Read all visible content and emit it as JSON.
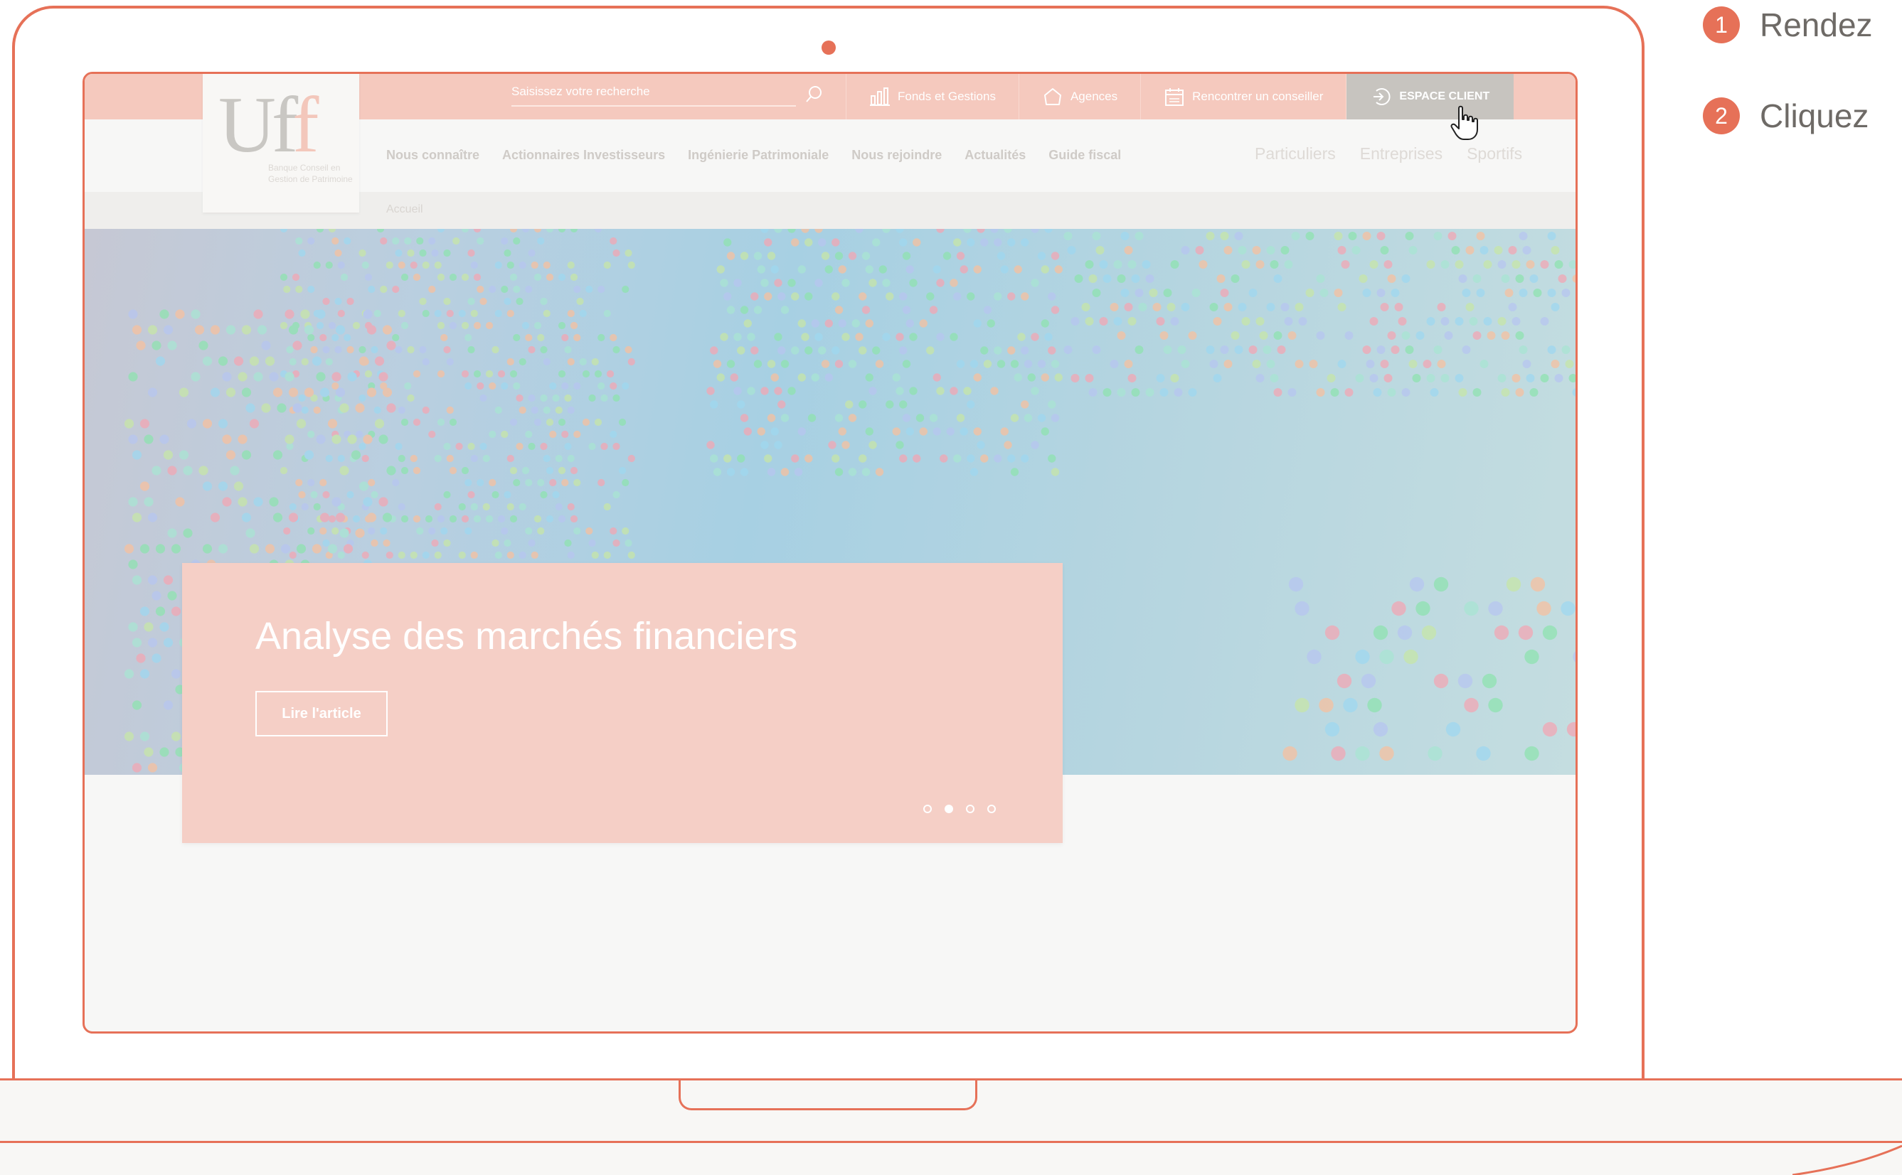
{
  "header": {
    "search": {
      "placeholder": "Saisissez votre recherche"
    },
    "topnav": [
      {
        "label": "Fonds et Gestions",
        "icon": "bar-chart-icon"
      },
      {
        "label": "Agences",
        "icon": "house-icon"
      },
      {
        "label": "Rencontrer un conseiller",
        "icon": "calendar-icon"
      },
      {
        "label": "ESPACE CLIENT",
        "icon": "login-icon"
      }
    ]
  },
  "logo": {
    "text_u": "U",
    "text_f1": "f",
    "text_f2": "f",
    "tagline": "Banque Conseil en Gestion de Patrimoine"
  },
  "mainnav": {
    "links": [
      "Nous connaître",
      "Actionnaires Investisseurs",
      "Ingénierie Patrimoniale",
      "Nous rejoindre",
      "Actualités",
      "Guide fiscal"
    ],
    "segments": [
      "Particuliers",
      "Entreprises",
      "Sportifs"
    ]
  },
  "breadcrumb": "Accueil",
  "hero": {
    "title": "Analyse des marchés financiers",
    "button": "Lire l'article",
    "slides": 4,
    "active_slide": 2
  },
  "instructions": [
    {
      "number": "1",
      "text": "Rendez"
    },
    {
      "number": "2",
      "text": "Cliquez"
    }
  ],
  "colors": {
    "accent": "#e67158",
    "topbar": "#f5c9be",
    "card": "#f5cfc6",
    "espace_bg": "#c7c4bf"
  }
}
